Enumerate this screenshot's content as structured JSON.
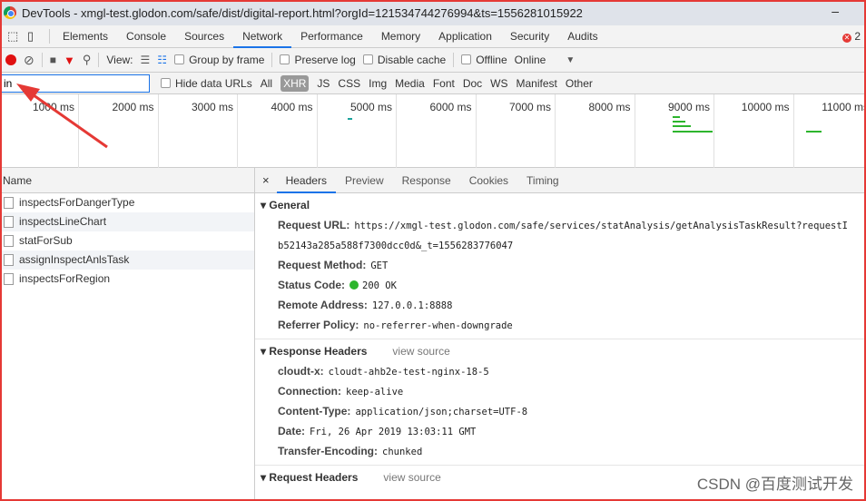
{
  "window": {
    "title": "DevTools - xmgl-test.glodon.com/safe/dist/digital-report.html?orgId=121534744276994&ts=1556281015922",
    "minimize": "–"
  },
  "tabs": [
    "Elements",
    "Console",
    "Sources",
    "Network",
    "Performance",
    "Memory",
    "Application",
    "Security",
    "Audits"
  ],
  "active_tab": "Network",
  "error_count": "2",
  "toolbar": {
    "view_label": "View:",
    "group_by_frame": "Group by frame",
    "preserve_log": "Preserve log",
    "disable_cache": "Disable cache",
    "offline": "Offline",
    "throttle": "Online"
  },
  "filter": {
    "value": "in",
    "hide_data_urls": "Hide data URLs",
    "types": [
      "All",
      "XHR",
      "JS",
      "CSS",
      "Img",
      "Media",
      "Font",
      "Doc",
      "WS",
      "Manifest",
      "Other"
    ],
    "active_type": "XHR"
  },
  "timeline": {
    "ticks": [
      "1000 ms",
      "2000 ms",
      "3000 ms",
      "4000 ms",
      "5000 ms",
      "6000 ms",
      "7000 ms",
      "8000 ms",
      "9000 ms",
      "10000 ms",
      "11000 ms"
    ]
  },
  "requests": {
    "header": "Name",
    "items": [
      "inspectsForDangerType",
      "inspectsLineChart",
      "statForSub",
      "assignInspectAnlsTask",
      "inspectsForRegion"
    ]
  },
  "detail": {
    "tabs": [
      "Headers",
      "Preview",
      "Response",
      "Cookies",
      "Timing"
    ],
    "close": "×",
    "general": {
      "title": "General",
      "url_label": "Request URL:",
      "url_line1": "https://xmgl-test.glodon.com/safe/services/statAnalysis/getAnalysisTaskResult?requestI",
      "url_line2": "b52143a285a588f7300dcc0d&_t=1556283776047",
      "method_label": "Request Method:",
      "method": "GET",
      "status_label": "Status Code:",
      "status": "200 OK",
      "status_color": "#2db52d",
      "remote_label": "Remote Address:",
      "remote": "127.0.0.1:8888",
      "referrer_label": "Referrer Policy:",
      "referrer": "no-referrer-when-downgrade"
    },
    "response_headers": {
      "title": "Response Headers",
      "view_source": "view source",
      "items": [
        {
          "k": "cloudt-x:",
          "v": "cloudt-ahb2e-test-nginx-18-5"
        },
        {
          "k": "Connection:",
          "v": "keep-alive"
        },
        {
          "k": "Content-Type:",
          "v": "application/json;charset=UTF-8"
        },
        {
          "k": "Date:",
          "v": "Fri, 26 Apr 2019 13:03:11 GMT"
        },
        {
          "k": "Transfer-Encoding:",
          "v": "chunked"
        }
      ]
    },
    "request_headers": {
      "title": "Request Headers",
      "view_source": "view source"
    }
  },
  "watermark": "CSDN @百度测试开发"
}
